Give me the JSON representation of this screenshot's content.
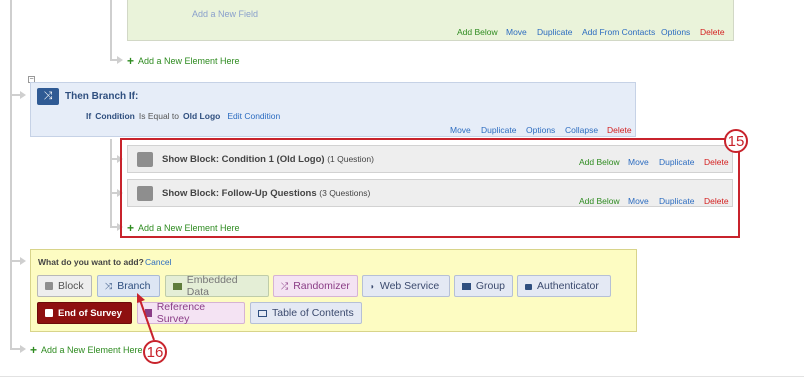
{
  "top_block": {
    "add_field_label": "Add a New Field",
    "actions": {
      "add_below": "Add Below",
      "move": "Move",
      "duplicate": "Duplicate",
      "add_from_contacts": "Add From Contacts",
      "options": "Options",
      "delete": "Delete"
    }
  },
  "add_element_label": "Add a New Element Here",
  "collapse_glyph": "−",
  "branch": {
    "title": "Then Branch If:",
    "condition_prefix": "If",
    "condition_field": "Condition",
    "condition_operator": "Is Equal to",
    "condition_value": "Old Logo",
    "edit_label": "Edit Condition",
    "actions": {
      "move": "Move",
      "duplicate": "Duplicate",
      "options": "Options",
      "collapse": "Collapse",
      "delete": "Delete"
    }
  },
  "blocks": [
    {
      "title": "Show Block: Condition 1 (Old Logo)",
      "count": "(1 Question)"
    },
    {
      "title": "Show Block: Follow-Up Questions",
      "count": "(3 Questions)"
    }
  ],
  "block_actions": {
    "add_below": "Add Below",
    "move": "Move",
    "duplicate": "Duplicate",
    "delete": "Delete"
  },
  "add_panel": {
    "question": "What do you want to add?",
    "cancel": "Cancel",
    "buttons": {
      "block": "Block",
      "branch": "Branch",
      "embedded_data": "Embedded Data",
      "randomizer": "Randomizer",
      "web_service": "Web Service",
      "group": "Group",
      "authenticator": "Authenticator",
      "end_of_survey": "End of Survey",
      "reference_survey": "Reference Survey",
      "table_of_contents": "Table of Contents"
    }
  },
  "callouts": {
    "c15": "15",
    "c16": "16"
  },
  "colors": {
    "highlight": "#c8232c",
    "branch_bg": "#e6edf8",
    "add_bg": "#fdfcc2",
    "top_block_bg": "#eaf3da"
  }
}
